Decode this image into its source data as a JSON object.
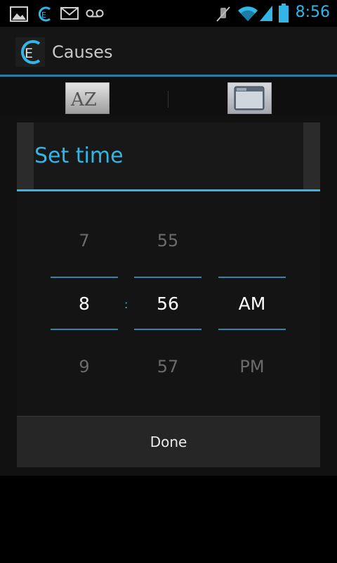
{
  "status_bar": {
    "time": "8:56",
    "icons": [
      "image-icon",
      "app-e-icon",
      "gmail-icon",
      "voicemail-icon",
      "mute-icon",
      "wifi-icon",
      "signal-icon",
      "battery-icon"
    ]
  },
  "action_bar": {
    "title": "Causes",
    "logo_letter": "E"
  },
  "toolbar": {
    "sort_icon_text": "AZ",
    "icons": [
      "sort-az-icon",
      "window-icon"
    ]
  },
  "dialog": {
    "title": "Set time",
    "hour": {
      "prev": "7",
      "current": "8",
      "next": "9"
    },
    "minute": {
      "prev": "55",
      "current": "56",
      "next": "57"
    },
    "ampm": {
      "prev": "",
      "current": "AM",
      "next": "PM"
    },
    "separator": ":",
    "done_label": "Done"
  },
  "colors": {
    "accent": "#33b5e5",
    "divider": "#2a7fa1"
  }
}
